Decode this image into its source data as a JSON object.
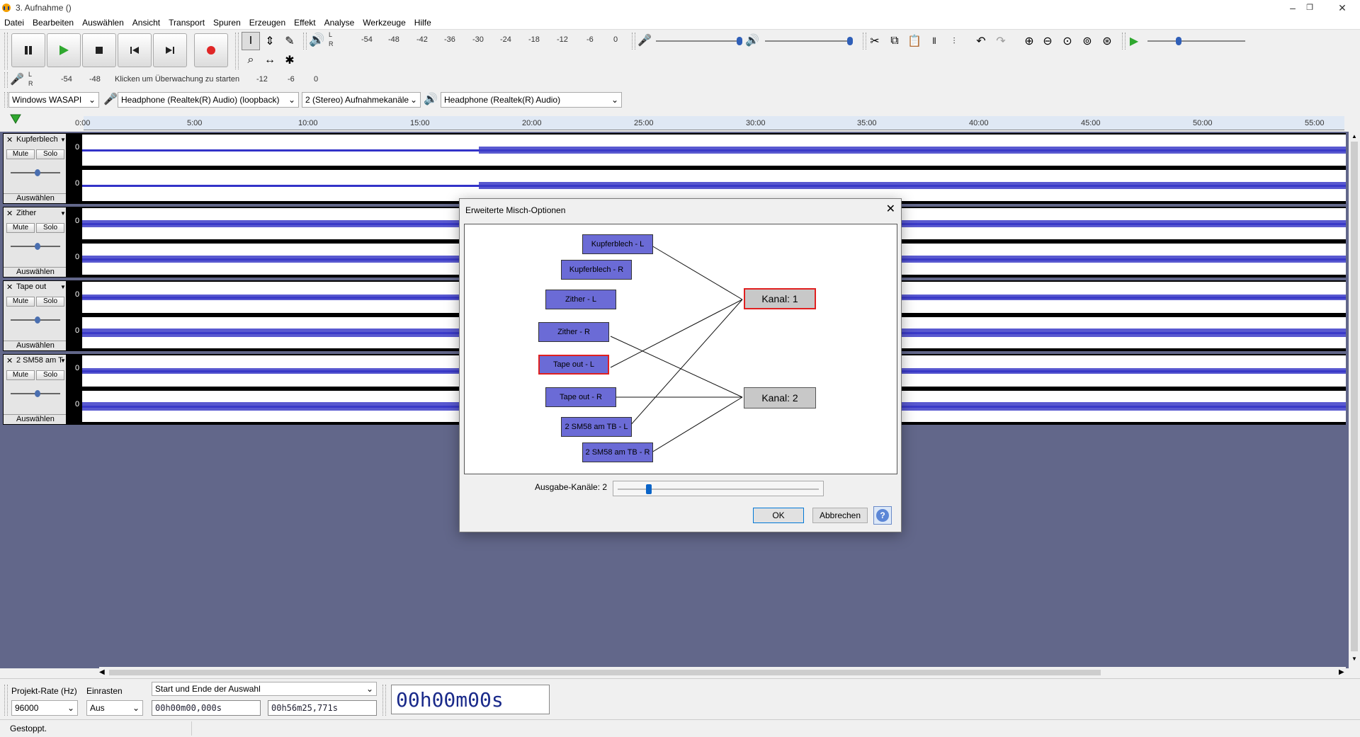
{
  "window": {
    "title": "3. Aufnahme ()",
    "minimize": "–",
    "restore": "❐",
    "close": "✕"
  },
  "menu": [
    "Datei",
    "Bearbeiten",
    "Auswählen",
    "Ansicht",
    "Transport",
    "Spuren",
    "Erzeugen",
    "Effekt",
    "Analyse",
    "Werkzeuge",
    "Hilfe"
  ],
  "meter": {
    "playback_ticks": [
      "-54",
      "-48",
      "-42",
      "-36",
      "-30",
      "-24",
      "-18",
      "-12",
      "-6",
      "0"
    ],
    "record_ticks": [
      "-54",
      "-48",
      "-12",
      "-6",
      "0"
    ],
    "record_hint": "Klicken um Überwachung zu starten",
    "lr_l": "L",
    "lr_r": "R"
  },
  "device": {
    "host": "Windows WASAPI",
    "input": "Headphone (Realtek(R) Audio) (loopback)",
    "channels": "2 (Stereo) Aufnahmekanäle",
    "output": "Headphone (Realtek(R) Audio)"
  },
  "timeline": [
    "0:00",
    "5:00",
    "10:00",
    "15:00",
    "20:00",
    "25:00",
    "30:00",
    "35:00",
    "40:00",
    "45:00",
    "50:00",
    "55:00"
  ],
  "tracks": [
    {
      "name": "Kupferblech",
      "mute": "Mute",
      "solo": "Solo",
      "select": "Auswählen",
      "zero": "0"
    },
    {
      "name": "Zither",
      "mute": "Mute",
      "solo": "Solo",
      "select": "Auswählen",
      "zero": "0"
    },
    {
      "name": "Tape out",
      "mute": "Mute",
      "solo": "Solo",
      "select": "Auswählen",
      "zero": "0"
    },
    {
      "name": "2 SM58 am T",
      "mute": "Mute",
      "solo": "Solo",
      "select": "Auswählen",
      "zero": "0"
    }
  ],
  "bottom": {
    "rate_label": "Projekt-Rate (Hz)",
    "rate_value": "96000",
    "snap_label": "Einrasten",
    "snap_value": "Aus",
    "selection_mode": "Start und Ende der Auswahl",
    "sel_start": "00h00m00,000s",
    "sel_end": "00h56m25,771s",
    "position": "00h00m00s"
  },
  "status": "Gestoppt.",
  "dialog": {
    "title": "Erweiterte Misch-Optionen",
    "inputs": [
      "Kupferblech - L",
      "Kupferblech - R",
      "Zither - L",
      "Zither - R",
      "Tape out - L",
      "Tape out - R",
      "2 SM58 am TB - L",
      "2 SM58 am TB - R"
    ],
    "outputs": [
      "Kanal:  1",
      "Kanal:  2"
    ],
    "output_channels_label": "Ausgabe-Kanäle:  2",
    "ok": "OK",
    "cancel": "Abbrechen",
    "help": "?"
  }
}
